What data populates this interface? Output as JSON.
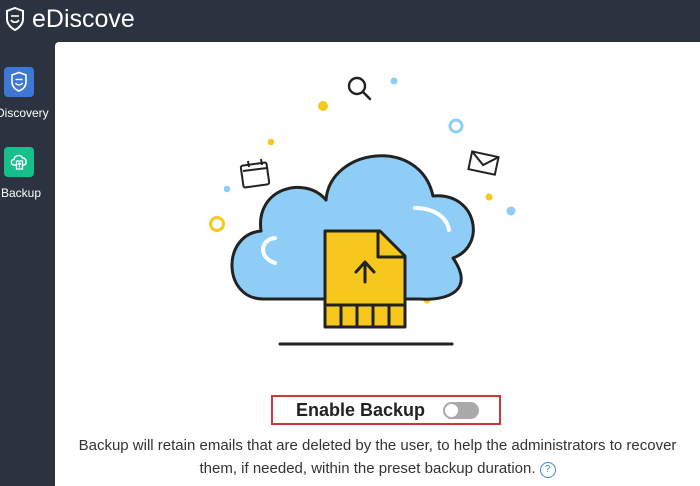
{
  "header": {
    "title": "eDiscovery",
    "logo_icon": "shield-icon"
  },
  "sidebar": {
    "items": [
      {
        "label": "Discovery",
        "icon": "shield-icon",
        "color": "#3e78d6"
      },
      {
        "label": "Backup",
        "icon": "cloud-backup-icon",
        "color": "#16c08a"
      }
    ]
  },
  "main": {
    "illustration": "cloud-upload-illustration",
    "enable_backup_label": "Enable Backup",
    "enable_backup_on": false,
    "description": "Backup will retain emails that are deleted by the user, to help the administrators to recover them, if needed, within the preset backup duration.",
    "help_symbol": "?"
  },
  "colors": {
    "background": "#2b3340",
    "highlight_border": "#d1383d",
    "cloud_fill": "#8ecdf5",
    "file_fill": "#f6c81d",
    "toggle_off": "#a9a9a9"
  }
}
